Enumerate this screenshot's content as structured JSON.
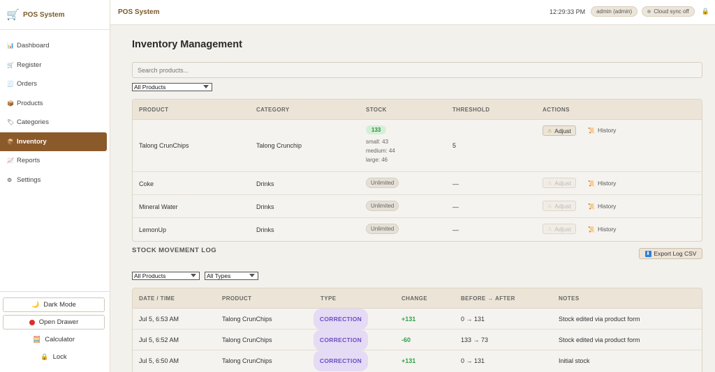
{
  "app": {
    "brand": "POS System",
    "title": "POS System"
  },
  "topbar": {
    "time": "12:29:33 PM",
    "user": "admin (admin)",
    "sync": "Cloud sync off"
  },
  "sidebar": {
    "items": [
      {
        "label": "Dashboard",
        "icon": "chart-icon"
      },
      {
        "label": "Register",
        "icon": "cart-icon"
      },
      {
        "label": "Orders",
        "icon": "receipt-icon"
      },
      {
        "label": "Products",
        "icon": "box-icon"
      },
      {
        "label": "Categories",
        "icon": "tag-icon"
      },
      {
        "label": "Inventory",
        "icon": "package-icon",
        "active": true
      },
      {
        "label": "Reports",
        "icon": "trend-icon"
      },
      {
        "label": "Settings",
        "icon": "gear-icon"
      }
    ],
    "dark_mode": "Dark Mode",
    "open_drawer": "Open Drawer",
    "calculator": "Calculator",
    "lock": "Lock"
  },
  "main": {
    "title": "Inventory Management",
    "search_placeholder": "Search products...",
    "filter": "All Products",
    "columns": [
      "PRODUCT",
      "CATEGORY",
      "STOCK",
      "THRESHOLD",
      "ACTIONS"
    ],
    "rows": [
      {
        "product": "Talong CrunChips",
        "category": "Talong Crunchip",
        "stock": "133",
        "variants": [
          "small: 43",
          "medium: 44",
          "large: 46"
        ],
        "threshold": "5"
      },
      {
        "product": "Coke",
        "category": "Drinks",
        "stock": "Unlimited",
        "threshold": "—"
      },
      {
        "product": "Mineral Water",
        "category": "Drinks",
        "stock": "Unlimited",
        "threshold": "—"
      },
      {
        "product": "LemonUp",
        "category": "Drinks",
        "stock": "Unlimited",
        "threshold": "—"
      }
    ],
    "adjust_label": "Adjust",
    "history_label": "History"
  },
  "log": {
    "title": "STOCK MOVEMENT LOG",
    "export_label": "Export Log CSV",
    "filter_product": "All Products",
    "filter_type": "All Types",
    "columns": [
      "DATE / TIME",
      "PRODUCT",
      "TYPE",
      "CHANGE",
      "BEFORE → AFTER",
      "NOTES"
    ],
    "rows": [
      {
        "date": "Jul 5, 6:53 AM",
        "product": "Talong CrunChips",
        "type": "CORRECTION",
        "change": "+131",
        "before_after": "0 → 131",
        "notes": "Stock edited via product form"
      },
      {
        "date": "Jul 5, 6:52 AM",
        "product": "Talong CrunChips",
        "type": "CORRECTION",
        "change": "-60",
        "before_after": "133 → 73",
        "notes": "Stock edited via product form"
      },
      {
        "date": "Jul 5, 6:50 AM",
        "product": "Talong CrunChips",
        "type": "CORRECTION",
        "change": "+131",
        "before_after": "0 → 131",
        "notes": "Initial stock"
      }
    ]
  }
}
